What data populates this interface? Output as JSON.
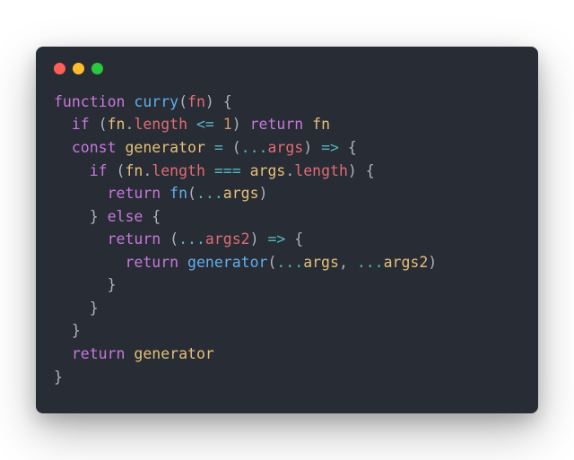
{
  "traffic": {
    "close_color": "#ff5f56",
    "minimize_color": "#ffbd2e",
    "zoom_color": "#27c93f"
  },
  "colors": {
    "bg": "#282c34",
    "keyword": "#c678dd",
    "funcname": "#61afef",
    "param": "#e06c75",
    "prop": "#e06c75",
    "ident": "#e5c07b",
    "punct": "#abb2bf",
    "operator": "#56b6c2",
    "number": "#d19a66"
  },
  "code": {
    "tokens": [
      [
        [
          "keyword",
          "function"
        ],
        [
          "punct",
          " "
        ],
        [
          "funcname",
          "curry"
        ],
        [
          "punct",
          "("
        ],
        [
          "param",
          "fn"
        ],
        [
          "punct",
          ") {"
        ]
      ],
      [
        [
          "punct",
          "  "
        ],
        [
          "keyword",
          "if"
        ],
        [
          "punct",
          " ("
        ],
        [
          "ident",
          "fn"
        ],
        [
          "punct",
          "."
        ],
        [
          "prop",
          "length"
        ],
        [
          "punct",
          " "
        ],
        [
          "operator",
          "<="
        ],
        [
          "punct",
          " "
        ],
        [
          "number",
          "1"
        ],
        [
          "punct",
          ") "
        ],
        [
          "keyword",
          "return"
        ],
        [
          "punct",
          " "
        ],
        [
          "ident",
          "fn"
        ]
      ],
      [
        [
          "punct",
          "  "
        ],
        [
          "keyword",
          "const"
        ],
        [
          "punct",
          " "
        ],
        [
          "ident",
          "generator"
        ],
        [
          "punct",
          " "
        ],
        [
          "operator",
          "="
        ],
        [
          "punct",
          " ("
        ],
        [
          "operator",
          "..."
        ],
        [
          "param",
          "args"
        ],
        [
          "punct",
          ") "
        ],
        [
          "operator",
          "=>"
        ],
        [
          "punct",
          " {"
        ]
      ],
      [
        [
          "punct",
          "    "
        ],
        [
          "keyword",
          "if"
        ],
        [
          "punct",
          " ("
        ],
        [
          "ident",
          "fn"
        ],
        [
          "punct",
          "."
        ],
        [
          "prop",
          "length"
        ],
        [
          "punct",
          " "
        ],
        [
          "operator",
          "==="
        ],
        [
          "punct",
          " "
        ],
        [
          "ident",
          "args"
        ],
        [
          "punct",
          "."
        ],
        [
          "prop",
          "length"
        ],
        [
          "punct",
          ") {"
        ]
      ],
      [
        [
          "punct",
          "      "
        ],
        [
          "keyword",
          "return"
        ],
        [
          "punct",
          " "
        ],
        [
          "funcname",
          "fn"
        ],
        [
          "punct",
          "("
        ],
        [
          "operator",
          "..."
        ],
        [
          "ident",
          "args"
        ],
        [
          "punct",
          ")"
        ]
      ],
      [
        [
          "punct",
          "    } "
        ],
        [
          "keyword",
          "else"
        ],
        [
          "punct",
          " {"
        ]
      ],
      [
        [
          "punct",
          "      "
        ],
        [
          "keyword",
          "return"
        ],
        [
          "punct",
          " ("
        ],
        [
          "operator",
          "..."
        ],
        [
          "param",
          "args2"
        ],
        [
          "punct",
          ") "
        ],
        [
          "operator",
          "=>"
        ],
        [
          "punct",
          " {"
        ]
      ],
      [
        [
          "punct",
          "        "
        ],
        [
          "keyword",
          "return"
        ],
        [
          "punct",
          " "
        ],
        [
          "funcname",
          "generator"
        ],
        [
          "punct",
          "("
        ],
        [
          "operator",
          "..."
        ],
        [
          "ident",
          "args"
        ],
        [
          "punct",
          ", "
        ],
        [
          "operator",
          "..."
        ],
        [
          "ident",
          "args2"
        ],
        [
          "punct",
          ")"
        ]
      ],
      [
        [
          "punct",
          "      }"
        ]
      ],
      [
        [
          "punct",
          "    }"
        ]
      ],
      [
        [
          "punct",
          "  }"
        ]
      ],
      [
        [
          "punct",
          "  "
        ],
        [
          "keyword",
          "return"
        ],
        [
          "punct",
          " "
        ],
        [
          "ident",
          "generator"
        ]
      ],
      [
        [
          "punct",
          "}"
        ]
      ]
    ]
  }
}
